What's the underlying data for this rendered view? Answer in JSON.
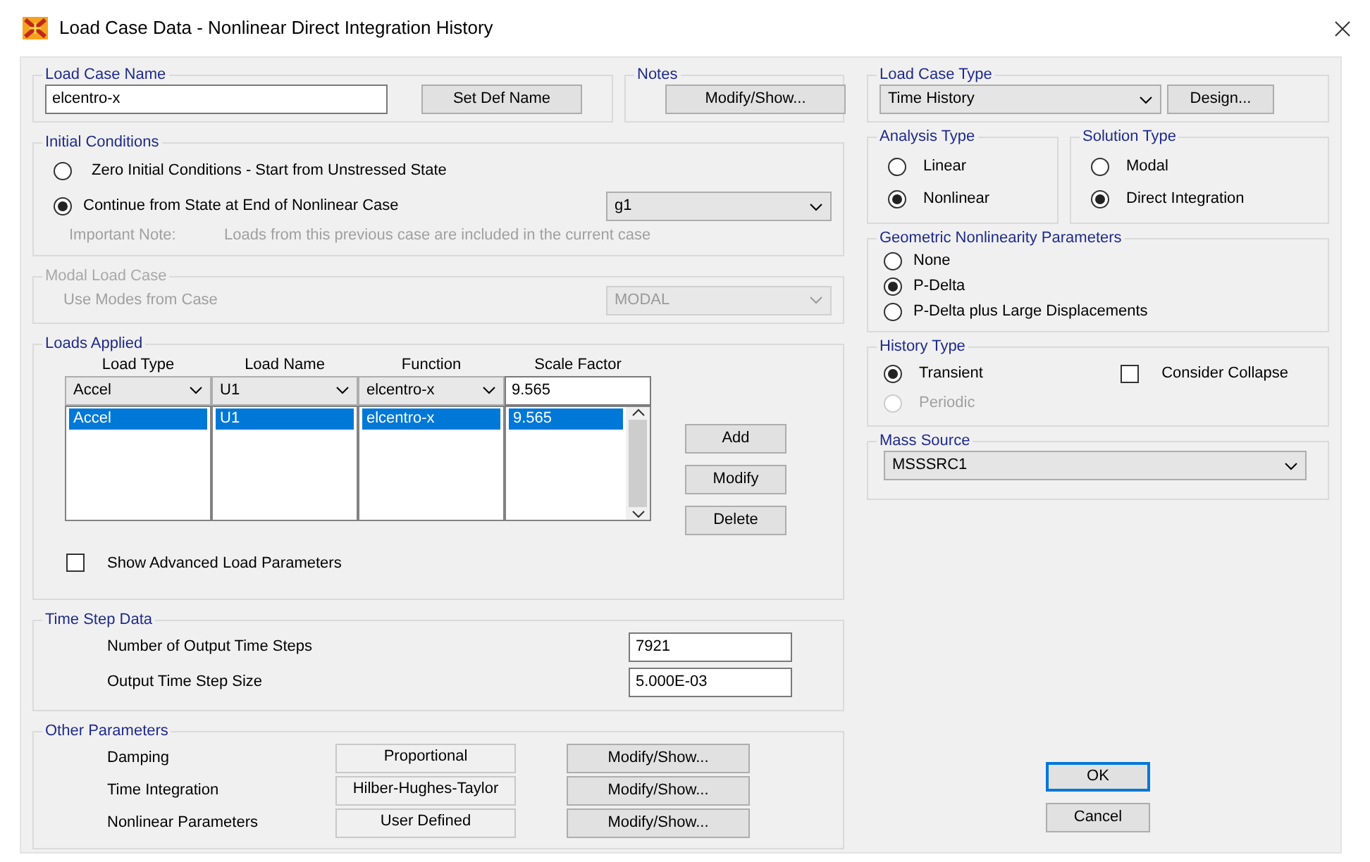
{
  "window": {
    "title": "Load Case Data - Nonlinear Direct Integration History"
  },
  "load_case_name": {
    "label": "Load Case Name",
    "value": "elcentro-x",
    "button": "Set Def Name"
  },
  "notes": {
    "label": "Notes",
    "button": "Modify/Show..."
  },
  "initial_conditions": {
    "label": "Initial Conditions",
    "options": [
      {
        "label": "Zero Initial Conditions - Start from Unstressed State",
        "selected": false
      },
      {
        "label": "Continue from State at End of Nonlinear Case",
        "selected": true
      }
    ],
    "case_dropdown": "g1",
    "note_label": "Important Note:",
    "note_text": "Loads from this previous case are included in the current case"
  },
  "modal_load_case": {
    "label": "Modal Load Case",
    "disabled": true,
    "field_label": "Use Modes from Case",
    "dropdown": "MODAL"
  },
  "loads_applied": {
    "label": "Loads Applied",
    "columns": [
      "Load Type",
      "Load Name",
      "Function",
      "Scale Factor"
    ],
    "edit_row": [
      "Accel",
      "U1",
      "elcentro-x",
      "9.565"
    ],
    "rows": [
      {
        "cells": [
          "Accel",
          "U1",
          "elcentro-x",
          "9.565"
        ],
        "selected": true
      }
    ],
    "buttons": [
      "Add",
      "Modify",
      "Delete"
    ],
    "advanced": {
      "label": "Show Advanced Load Parameters",
      "checked": false
    }
  },
  "time_step_data": {
    "label": "Time Step Data",
    "fields": [
      {
        "label": "Number of Output Time Steps",
        "value": "7921"
      },
      {
        "label": "Output Time Step Size",
        "value": "5.000E-03"
      }
    ]
  },
  "other_parameters": {
    "label": "Other Parameters",
    "rows": [
      {
        "label": "Damping",
        "value": "Proportional",
        "button": "Modify/Show..."
      },
      {
        "label": "Time Integration",
        "value": "Hilber-Hughes-Taylor",
        "button": "Modify/Show..."
      },
      {
        "label": "Nonlinear Parameters",
        "value": "User Defined",
        "button": "Modify/Show..."
      }
    ]
  },
  "load_case_type": {
    "label": "Load Case Type",
    "dropdown": "Time History",
    "button": "Design..."
  },
  "analysis_type": {
    "label": "Analysis Type",
    "options": [
      {
        "label": "Linear",
        "selected": false
      },
      {
        "label": "Nonlinear",
        "selected": true
      }
    ]
  },
  "solution_type": {
    "label": "Solution Type",
    "options": [
      {
        "label": "Modal",
        "selected": false
      },
      {
        "label": "Direct Integration",
        "selected": true
      }
    ]
  },
  "geometric_nonlinearity": {
    "label": "Geometric Nonlinearity Parameters",
    "options": [
      {
        "label": "None",
        "selected": false
      },
      {
        "label": "P-Delta",
        "selected": true
      },
      {
        "label": "P-Delta plus Large Displacements",
        "selected": false
      }
    ]
  },
  "history_type": {
    "label": "History Type",
    "options": [
      {
        "label": "Transient",
        "selected": true,
        "disabled": false
      },
      {
        "label": "Periodic",
        "selected": false,
        "disabled": true
      }
    ],
    "consider_collapse": {
      "label": "Consider Collapse",
      "checked": false
    }
  },
  "mass_source": {
    "label": "Mass Source",
    "dropdown": "MSSSRC1"
  },
  "dialog_buttons": [
    {
      "label": "OK",
      "default": true
    },
    {
      "label": "Cancel",
      "default": false
    }
  ]
}
